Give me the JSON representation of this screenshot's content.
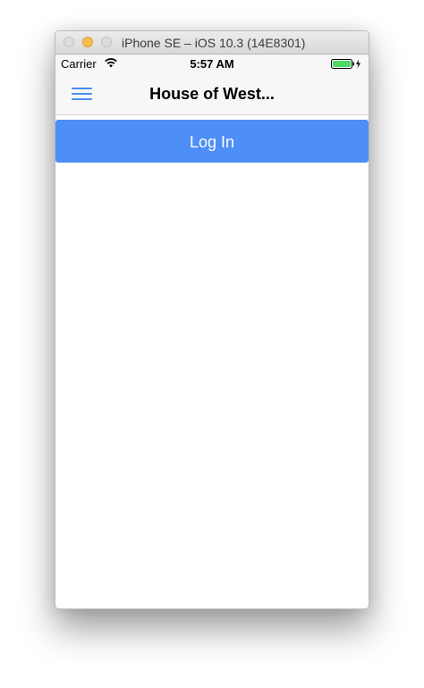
{
  "window": {
    "title": "iPhone SE – iOS 10.3 (14E8301)"
  },
  "status_bar": {
    "carrier": "Carrier",
    "time": "5:57 AM",
    "wifi_icon": "wifi-icon",
    "battery_icon": "battery-charging-icon",
    "battery_color": "#4cd964",
    "battery_level": 1.0
  },
  "nav": {
    "menu_icon": "hamburger-menu-icon",
    "title": "House of West..."
  },
  "main": {
    "login_label": "Log In"
  },
  "colors": {
    "accent": "#4a8cf5",
    "button_bg": "#4e8ef7"
  }
}
